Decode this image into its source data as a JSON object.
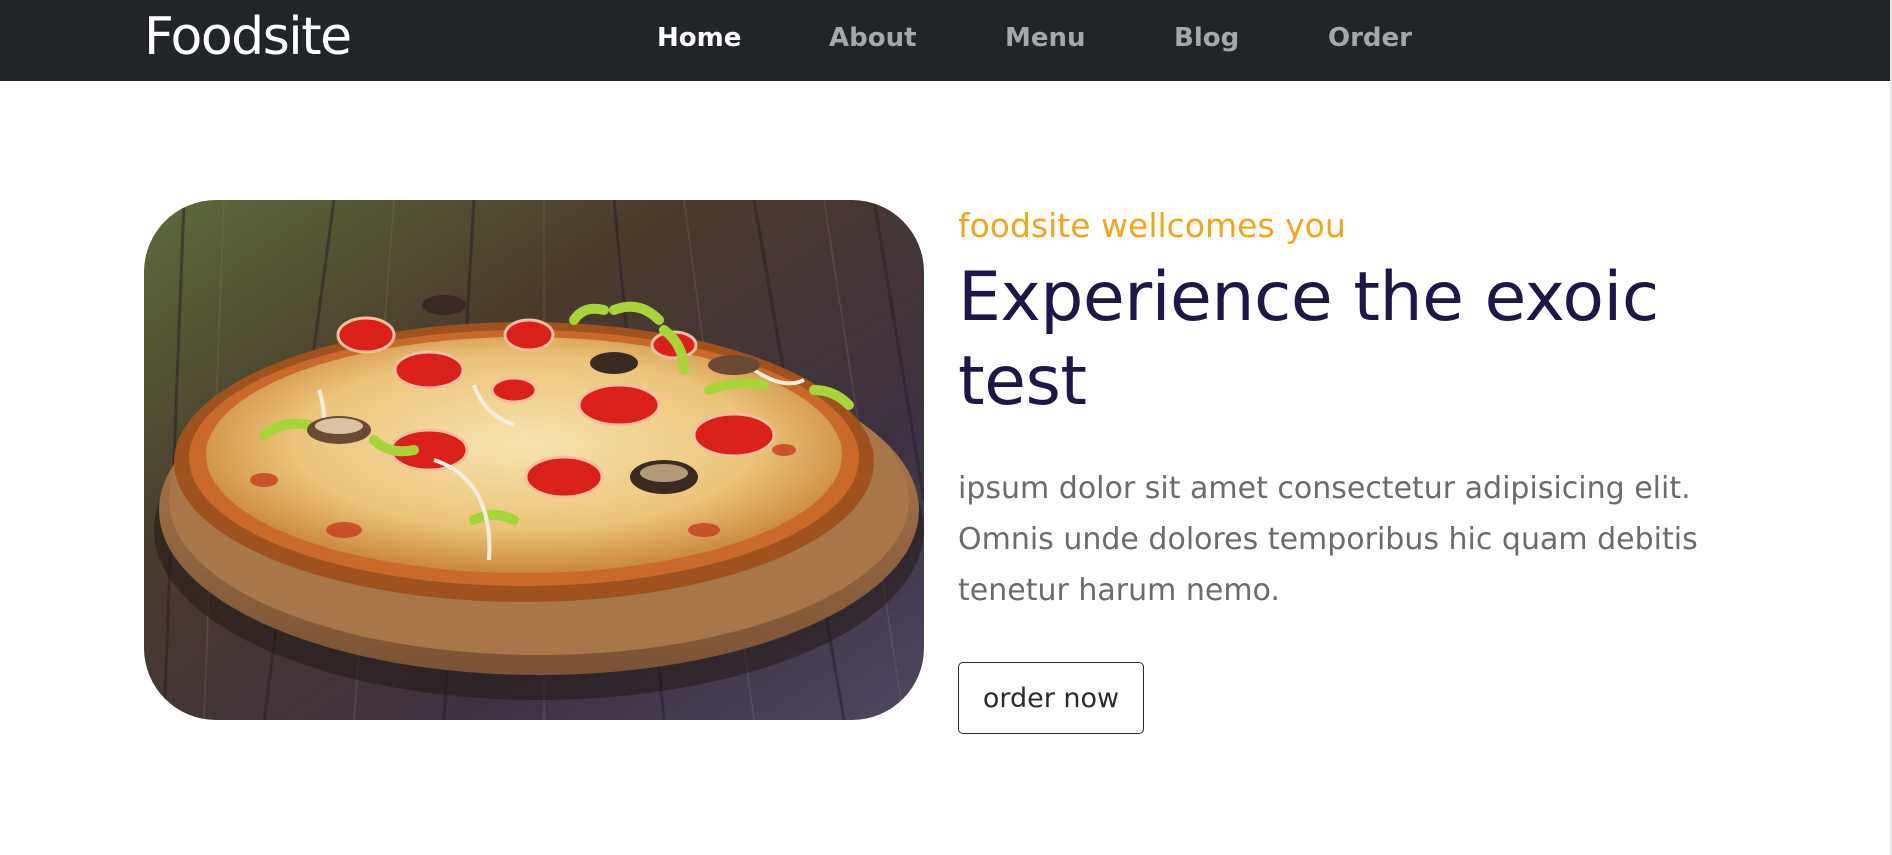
{
  "navbar": {
    "brand": "Foodsite",
    "links": [
      {
        "label": "Home",
        "active": true
      },
      {
        "label": "About",
        "active": false
      },
      {
        "label": "Menu",
        "active": false
      },
      {
        "label": "Blog",
        "active": false
      },
      {
        "label": "Order",
        "active": false
      }
    ]
  },
  "hero": {
    "image_subject": "pizza-photo",
    "tagline": "foodsite wellcomes you",
    "headline": "Experience the exoic test",
    "description": "ipsum dolor sit amet consectetur adipisicing elit. Omnis unde dolores temporibus hic quam debitis tenetur harum nemo.",
    "button_label": "order now"
  },
  "colors": {
    "navbar_bg": "#212529",
    "accent": "#f5a51c",
    "headline": "#1c1746",
    "body_text": "#6b6b6b"
  }
}
